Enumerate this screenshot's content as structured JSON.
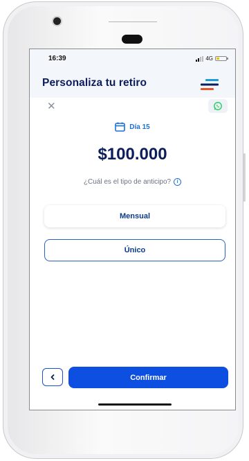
{
  "status_bar": {
    "time": "16:39",
    "network": "4G"
  },
  "header": {
    "title": "Personaliza tu retiro",
    "menu_icon": "menu-icon",
    "brand_colors": [
      "#0b1e5b",
      "#1d6fd6",
      "#e8542a"
    ]
  },
  "close_icon": "close-icon",
  "whatsapp_icon": "whatsapp-icon",
  "date": {
    "icon": "calendar-icon",
    "label": "Día 15"
  },
  "amount": "$100.000",
  "question": {
    "text": "¿Cuál es el tipo de anticipo?",
    "icon": "info-icon"
  },
  "options": [
    {
      "label": "Mensual"
    },
    {
      "label": "Único"
    }
  ],
  "footer": {
    "back_icon": "chevron-left-icon",
    "confirm_label": "Confirmar"
  },
  "colors": {
    "primary": "#0d4fe0",
    "navy": "#0b1e5b",
    "accent_blue": "#1d6fd6",
    "whatsapp_green": "#25d366"
  }
}
